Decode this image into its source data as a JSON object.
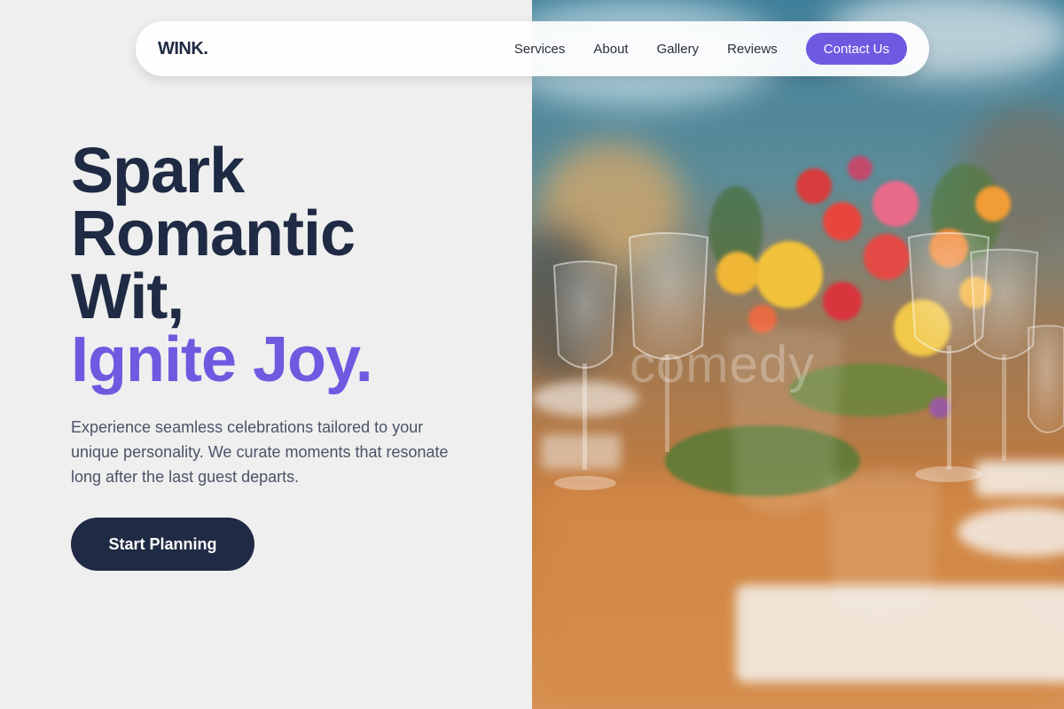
{
  "brand": {
    "logo": "WINK."
  },
  "nav": {
    "links": [
      "Services",
      "About",
      "Gallery",
      "Reviews"
    ],
    "cta_label": "Contact Us"
  },
  "hero": {
    "title_lines": [
      "Spark",
      "Romantic",
      "Wit,"
    ],
    "title_accent": "Ignite Joy.",
    "description": "Experience seamless celebrations tailored to your unique personality. We curate moments that resonate long after the last guest departs.",
    "button_label": "Start Planning"
  },
  "photo": {
    "watermark": "comedy"
  },
  "colors": {
    "accent": "#6d5ae0",
    "dark": "#1f2a44",
    "body_text": "#4a5366",
    "background": "#efefef"
  },
  "icons": []
}
